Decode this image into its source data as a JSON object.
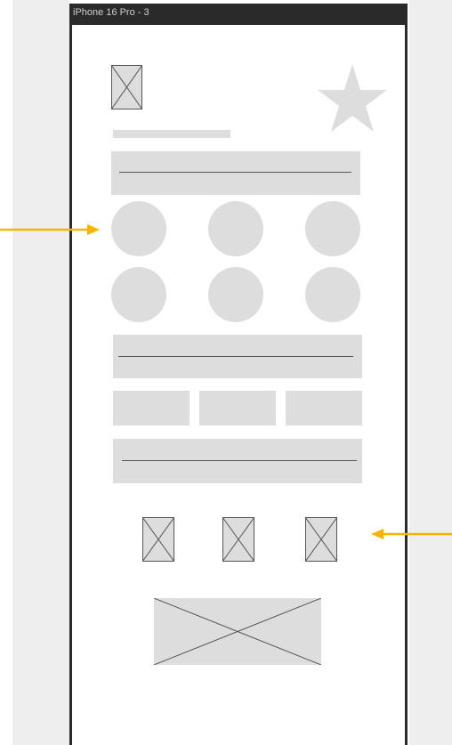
{
  "frame": {
    "title": "iPhone 16 Pro - 3"
  },
  "wireframe": {
    "image_icon": "image-placeholder-icon",
    "star_icon": "star-icon",
    "circle_count": 6,
    "tab_count": 3,
    "small_image_count": 3
  },
  "colors": {
    "placeholder": "#dddddd",
    "frame_border": "#2a2a2a",
    "annotation_arrow": "#f4b400",
    "side_panel": "#eeeeee"
  }
}
